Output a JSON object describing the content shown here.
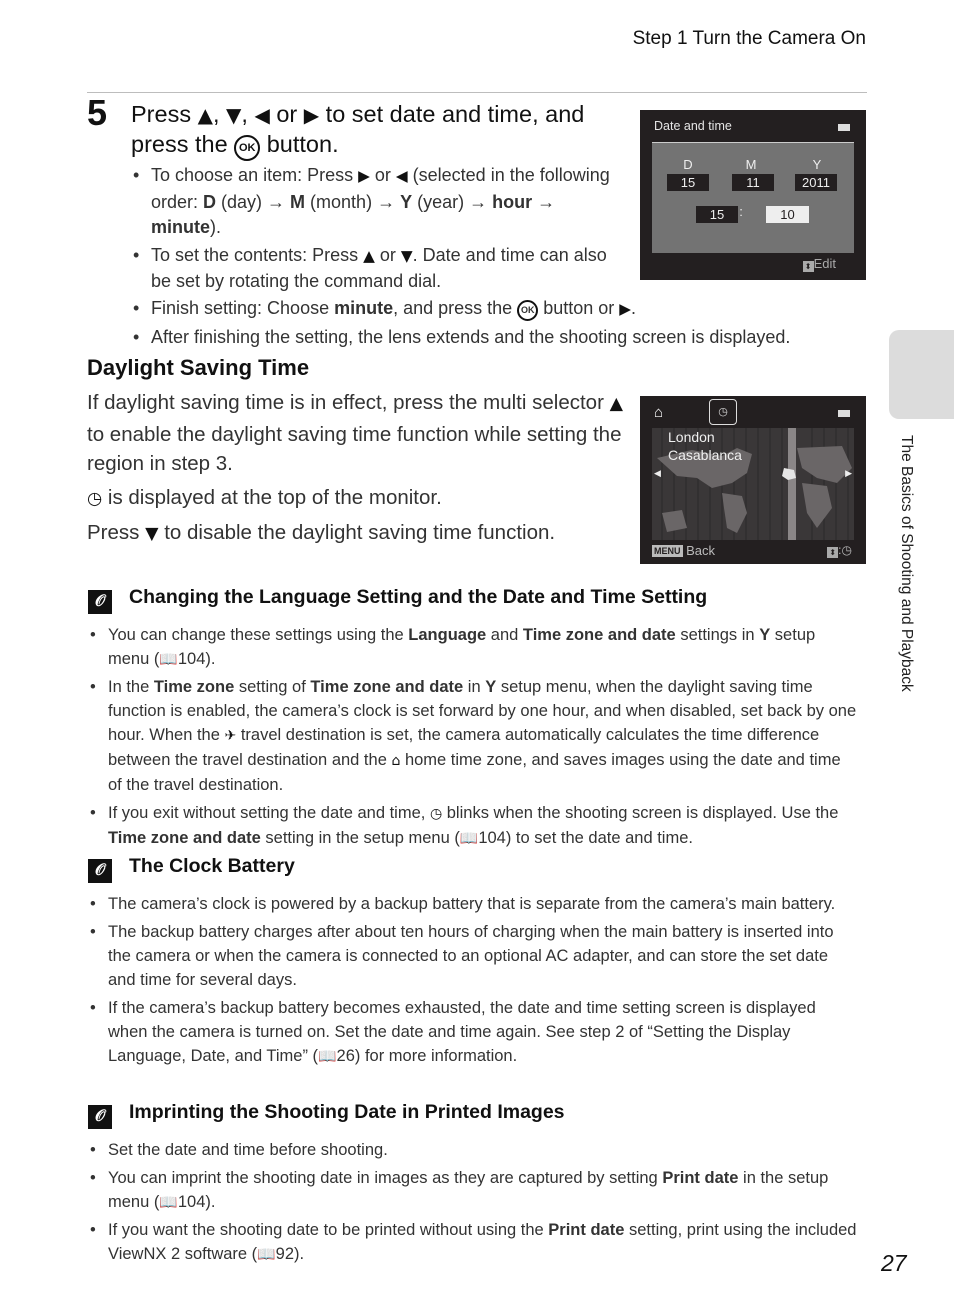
{
  "header": {
    "title": "Step 1 Turn the Camera On"
  },
  "step": {
    "number": "5",
    "title_parts": [
      "Press ",
      "▲",
      ", ",
      "▼",
      ", ",
      "◀",
      " or ",
      "▶",
      " to set date and time, and press the ",
      "OK",
      " button."
    ],
    "bullets": [
      {
        "parts": [
          "To choose an item: Press ",
          "▶",
          " or ",
          "◀",
          " (selected in the following order: ",
          "D",
          " (day) → ",
          "M",
          " (month) → ",
          "Y",
          " (year) → ",
          "hour",
          " → ",
          "minute",
          ")."
        ]
      },
      {
        "parts": [
          "To set the contents: Press ",
          "▲",
          " or ",
          "▼",
          ". Date and time can also be set by rotating the command dial."
        ]
      },
      {
        "parts": [
          "Finish setting: Choose ",
          "minute",
          ", and press the ",
          "OK",
          " button or ",
          "▶",
          "."
        ]
      },
      {
        "parts": [
          "After finishing the setting, the lens extends and the shooting screen is displayed."
        ]
      }
    ]
  },
  "screen_date": {
    "title": "Date and time",
    "labels": [
      "D",
      "M",
      "Y"
    ],
    "values": [
      "15",
      "11",
      "2011"
    ],
    "hour": "15",
    "minute": "10",
    "separator": ":",
    "edit_label": "Edit"
  },
  "dst": {
    "heading": "Daylight Saving Time",
    "p1_a": "If daylight saving time is in effect, press the multi selector ",
    "p1_b": " to enable the daylight saving time function while setting the region in step 3.",
    "p2": " is displayed at the top of the monitor.",
    "p3_a": "Press ",
    "p3_b": " to disable the daylight saving time function.",
    "up_glyph": "▲",
    "down_glyph": "▼"
  },
  "screen_map": {
    "cities": [
      "London",
      "Casablanca"
    ],
    "menu_tag": "MENU",
    "back_label": "Back"
  },
  "notes": [
    {
      "heading": "Changing the Language Setting and the Date and Time Setting",
      "bullets": [
        [
          "You can change these settings using the ",
          "Language",
          " and ",
          "Time zone and date",
          " settings in ",
          "Y",
          " setup menu (",
          "📖",
          "104)."
        ],
        [
          "In the ",
          "Time zone",
          " setting of ",
          "Time zone and date",
          " in ",
          "Y",
          " setup menu, when the daylight saving time function is enabled, the camera’s clock is set forward by one hour, and when disabled, set back by one hour. When the ",
          "✈",
          " travel destination is set, the camera automatically calculates the time difference between the travel destination and the ",
          "⌂",
          " home time zone, and saves images using the date and time of the travel destination."
        ],
        [
          "If you exit without setting the date and time, ",
          "◷",
          " blinks when the shooting screen is displayed. Use the ",
          "Time zone and date",
          " setting in the setup menu (",
          "📖",
          "104) to set the date and time."
        ]
      ]
    },
    {
      "heading": "The Clock Battery",
      "bullets": [
        [
          "The camera’s clock is powered by a backup battery that is separate from the camera’s main battery."
        ],
        [
          "The backup battery charges after about ten hours of charging when the main battery is inserted into the camera or when the camera is connected to an optional AC adapter, and can store the set date and time for several days."
        ],
        [
          "If the camera’s backup battery becomes exhausted, the date and time setting screen is displayed when the camera is turned on. Set the date and time again. See step 2 of “Setting the Display Language, Date, and Time” (",
          "📖",
          "26) for more information."
        ]
      ]
    },
    {
      "heading": "Imprinting the Shooting Date in Printed Images",
      "bullets": [
        [
          "Set the date and time before shooting."
        ],
        [
          "You can imprint the shooting date in images as they are captured by setting ",
          "Print date",
          " in the setup menu (",
          "📖",
          "104)."
        ],
        [
          "If you want the shooting date to be printed without using the ",
          "Print date",
          " setting, print using the included ViewNX 2 software (",
          "📖",
          "92)."
        ]
      ]
    }
  ],
  "side_tab": {
    "label": "The Basics of Shooting and Playback"
  },
  "page_number": "27"
}
